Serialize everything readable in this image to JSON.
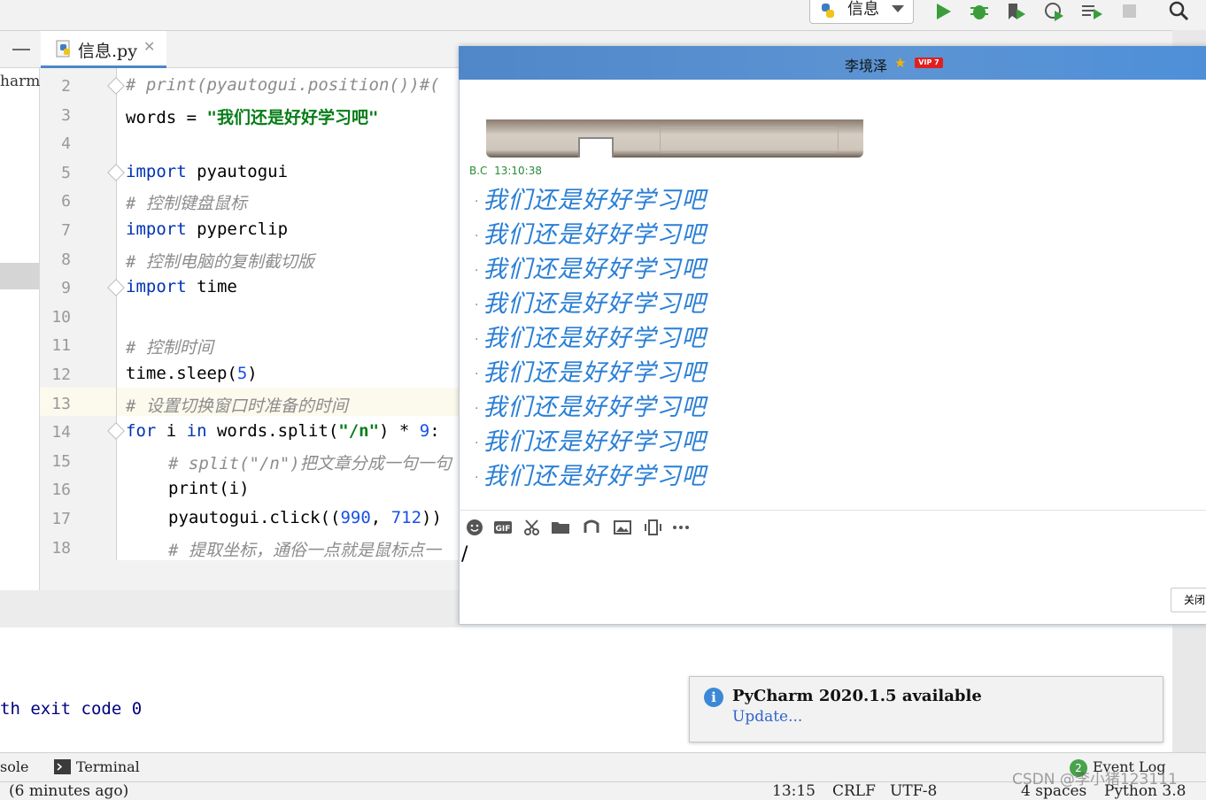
{
  "toolbar": {
    "run_config": "信息"
  },
  "editor": {
    "tab_filename": "信息.py",
    "project_fragment": "harm",
    "lines": [
      {
        "n": "2",
        "text": "# print(pyautogui.position())#("
      },
      {
        "n": "3",
        "pre": "words = ",
        "str": "\"我们还是好好学习吧\""
      },
      {
        "n": "4"
      },
      {
        "n": "5",
        "kw": "import",
        "rest": " pyautogui"
      },
      {
        "n": "6",
        "cmt": "# 控制键盘鼠标"
      },
      {
        "n": "7",
        "kw": "import",
        "rest": " pyperclip"
      },
      {
        "n": "8",
        "cmt": "# 控制电脑的复制截切版"
      },
      {
        "n": "9",
        "kw": "import",
        "rest": " time"
      },
      {
        "n": "10"
      },
      {
        "n": "11",
        "cmt": "# 控制时间"
      },
      {
        "n": "12",
        "pre": "time.sleep(",
        "num": "5",
        "post": ")"
      },
      {
        "n": "13",
        "cmt": "# 设置切换窗口时准备的时间"
      },
      {
        "n": "14",
        "kw": "for",
        "mid1": " i ",
        "kw2": "in",
        "mid2": " words.split(",
        "str": "\"/n\"",
        "mid3": ") * ",
        "num": "9",
        "post": ":"
      },
      {
        "n": "15",
        "cmt": "# split(\"/n\")把文章分成一句一句"
      },
      {
        "n": "16",
        "pre": "print(i)"
      },
      {
        "n": "17",
        "pre": "pyautogui.click((",
        "num": "990",
        "mid": ", ",
        "num2": "712",
        "post": "))"
      },
      {
        "n": "18",
        "cmt": "# 提取坐标，通俗一点就是鼠标点一"
      }
    ]
  },
  "console": {
    "output": "th exit code 0"
  },
  "bottom_tabs": {
    "console": "sole",
    "terminal": "Terminal",
    "event_log": "Event Log",
    "event_count": "2"
  },
  "status": {
    "left": "(6 minutes ago)",
    "position": "13:15",
    "line_sep": "CRLF",
    "encoding": "UTF-8",
    "indent": "4 spaces",
    "interpreter": "Python 3.8"
  },
  "chat": {
    "title": "李境泽",
    "vip": "VIP 7",
    "sender": "B.C",
    "time": "13:10:38",
    "messages": [
      "我们还是好好学习吧",
      "我们还是好好学习吧",
      "我们还是好好学习吧",
      "我们还是好好学习吧",
      "我们还是好好学习吧",
      "我们还是好好学习吧",
      "我们还是好好学习吧",
      "我们还是好好学习吧",
      "我们还是好好学习吧"
    ],
    "close_button": "关闭"
  },
  "notification": {
    "title": "PyCharm 2020.1.5 available",
    "link": "Update..."
  },
  "watermark": "CSDN @李小猪123111",
  "colors": {
    "keyword": "#0033b3",
    "string": "#067d17",
    "number": "#1750eb",
    "comment": "#8c8c8c",
    "chat_message": "#2a7fd6",
    "chat_header": "#4f87c9",
    "notification_link": "#2f65ca"
  }
}
